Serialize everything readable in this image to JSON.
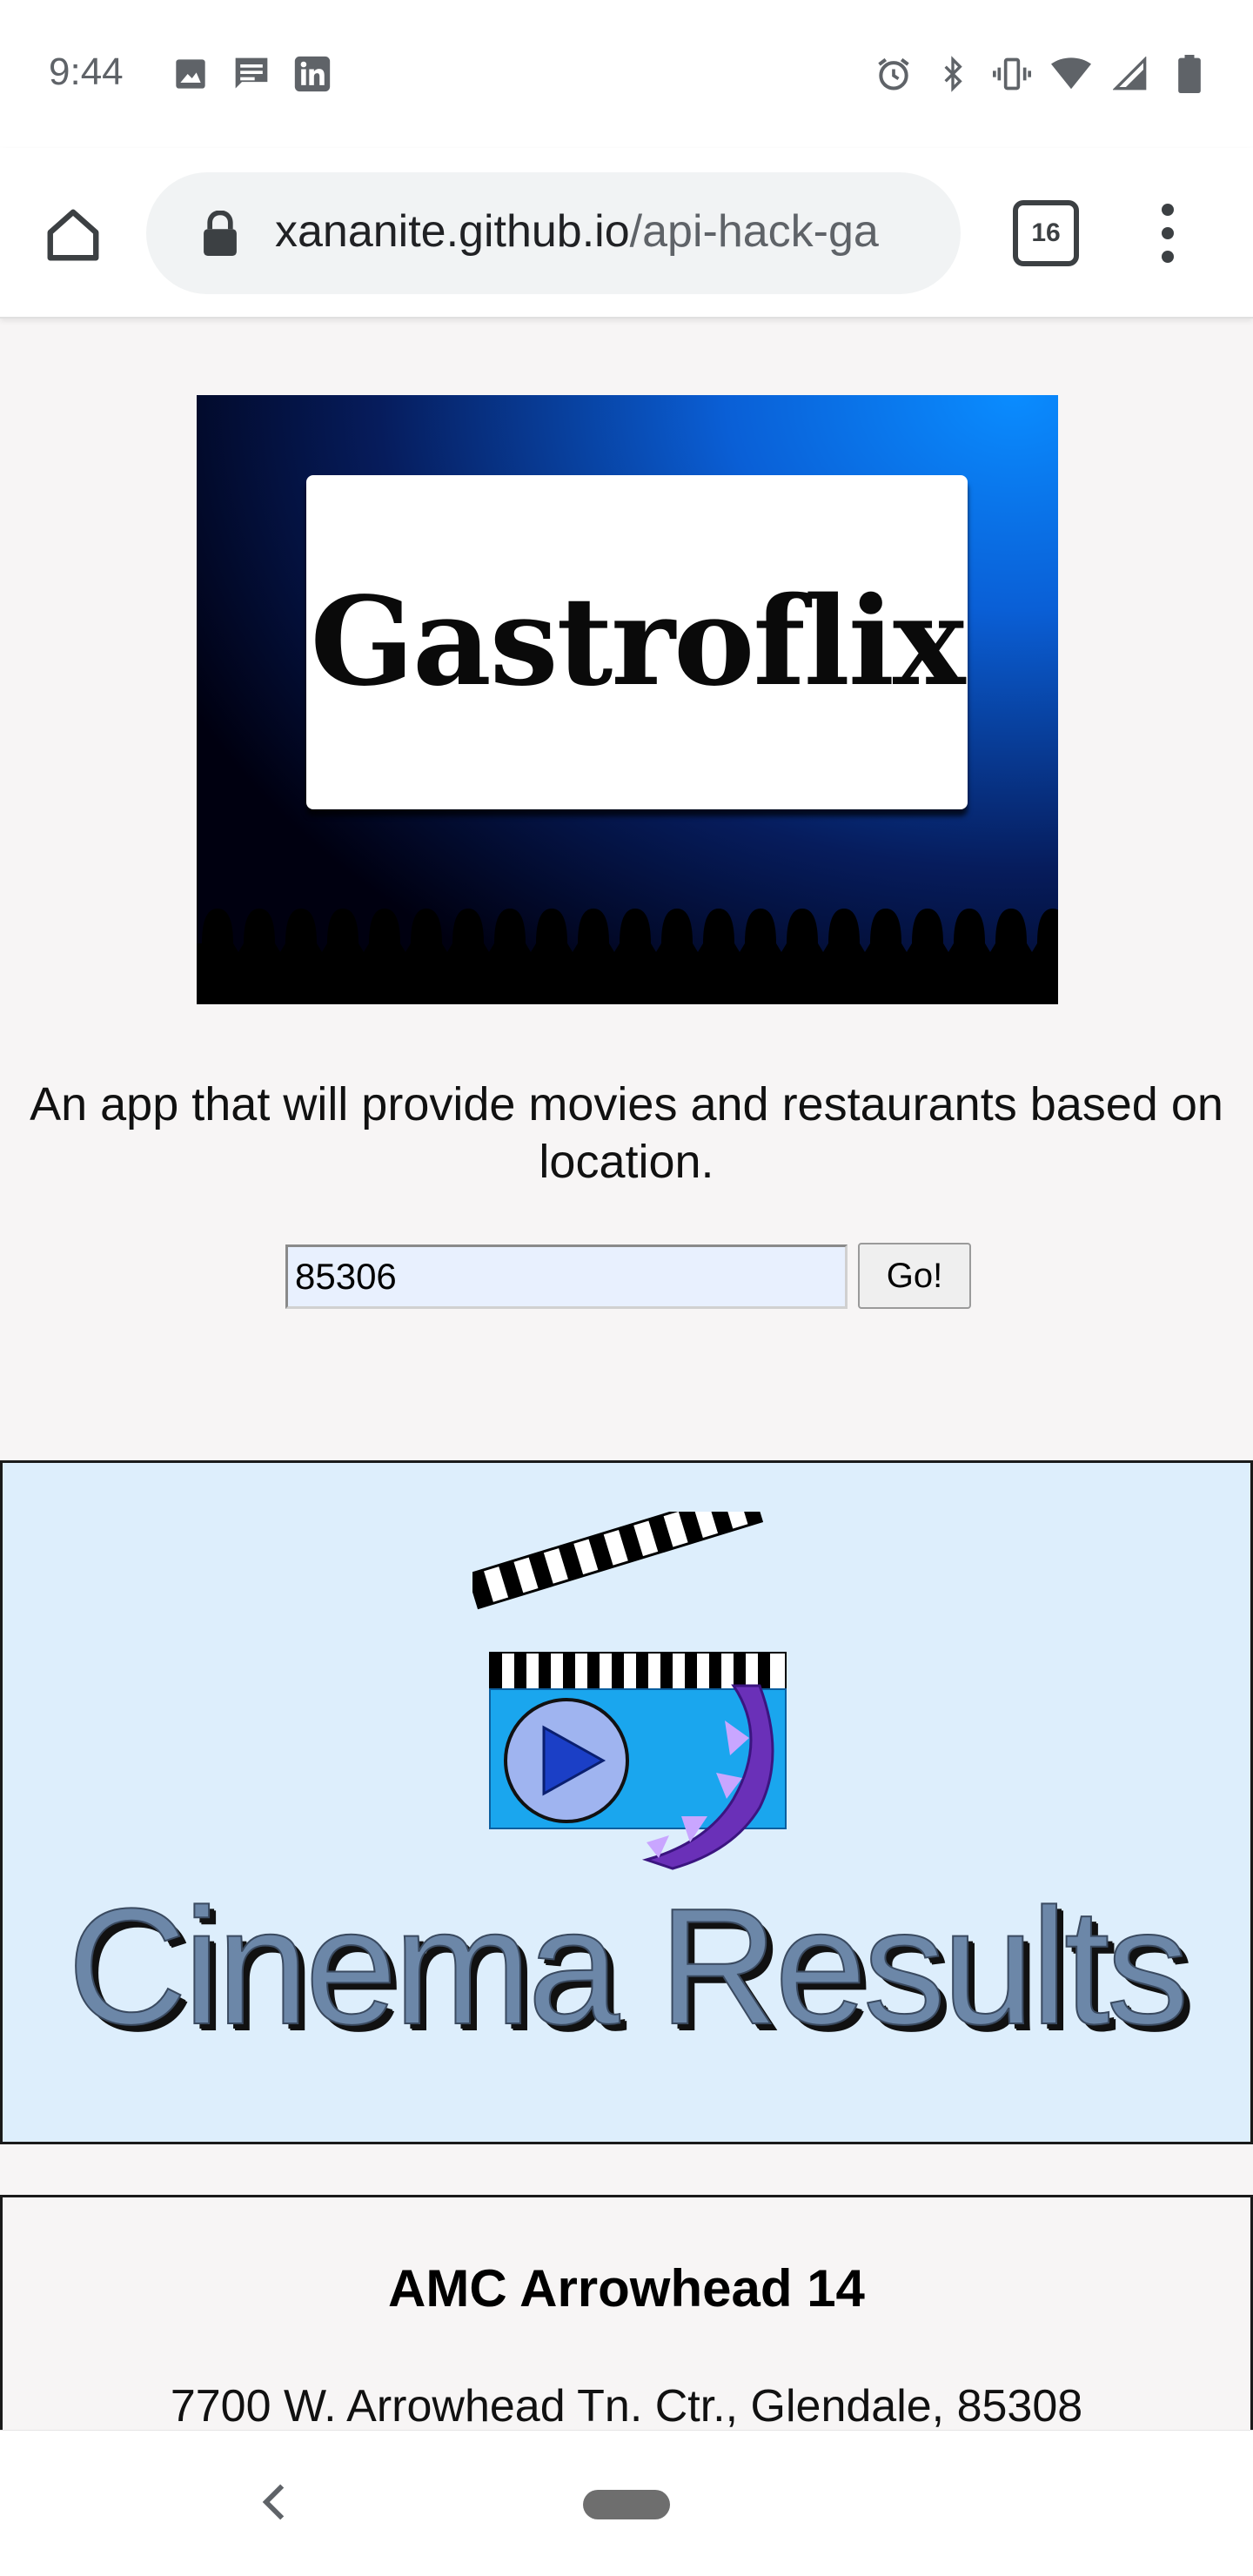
{
  "status_bar": {
    "time": "9:44",
    "left_icons": [
      "image-icon",
      "message-icon",
      "linkedin-icon"
    ],
    "right_icons": [
      "alarm-icon",
      "bluetooth-icon",
      "vibrate-icon",
      "wifi-icon",
      "signal-icon",
      "battery-icon"
    ]
  },
  "browser": {
    "url_host": "xananite.github.io",
    "url_path": "/api-hack-ga",
    "tab_count": "16"
  },
  "hero": {
    "logo_text": "Gastroflix"
  },
  "tagline": "An app that will provide movies and restaurants based on location.",
  "search": {
    "zip_value": "85306",
    "go_label": "Go!"
  },
  "cinema": {
    "title": "Cinema Results"
  },
  "theater": {
    "name": "AMC Arrowhead 14",
    "address": "7700 W. Arrowhead Tn. Ctr., Glendale, 85308"
  },
  "colors": {
    "cinema_bg": "#ddeefc",
    "cinema_title": "#6c87a8",
    "page_bg": "#f7f5f5",
    "input_bg": "#e8f0fe"
  }
}
